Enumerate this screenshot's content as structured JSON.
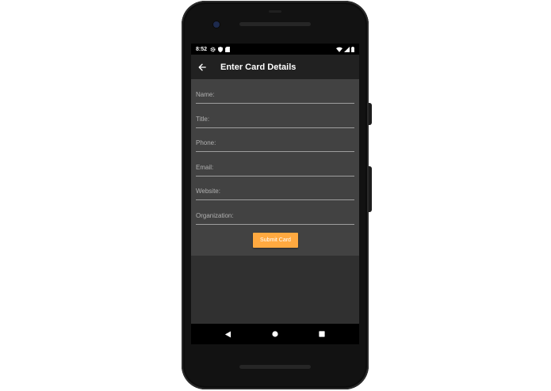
{
  "status_bar": {
    "time": "8:52",
    "left_icons": [
      "gear-icon",
      "shield-icon",
      "sd-card-icon"
    ],
    "right_icons": [
      "wifi-icon",
      "signal-icon",
      "battery-icon"
    ]
  },
  "app_bar": {
    "back_icon": "arrow-left-icon",
    "title": "Enter Card Details"
  },
  "form": {
    "fields": [
      {
        "placeholder": "Name:",
        "value": ""
      },
      {
        "placeholder": "Title:",
        "value": ""
      },
      {
        "placeholder": "Phone:",
        "value": ""
      },
      {
        "placeholder": "Email:",
        "value": ""
      },
      {
        "placeholder": "Website:",
        "value": ""
      },
      {
        "placeholder": "Organization:",
        "value": ""
      }
    ],
    "submit_label": "Submit Card"
  },
  "nav_bar": {
    "icons": [
      "back-triangle-icon",
      "home-circle-icon",
      "recents-square-icon"
    ]
  },
  "colors": {
    "accent": "#ffa940",
    "app_bar": "#212121",
    "form_card": "#424242",
    "background": "#303030",
    "underline": "#9e9e9e"
  }
}
